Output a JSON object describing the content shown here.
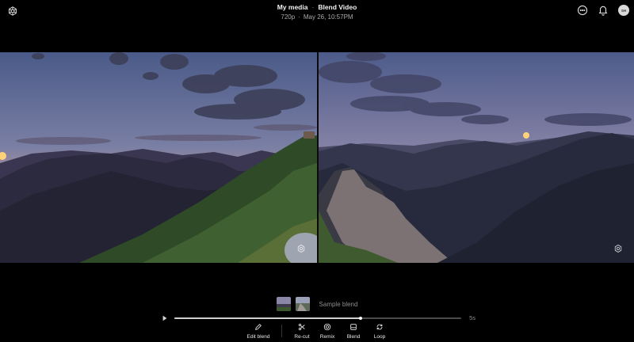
{
  "header": {
    "breadcrumb": [
      "My media",
      "Blend Video"
    ],
    "resolution": "720p",
    "date": "May 26, 10:57PM"
  },
  "icons": {
    "logo": "openai-logo-icon",
    "more": "more-options-icon",
    "notifications": "bell-icon",
    "avatar": "user-avatar"
  },
  "avatar_initials": "SH",
  "videos": [
    {
      "name": "left-clip",
      "description_icon": "watermark-icon"
    },
    {
      "name": "right-clip",
      "description_icon": "watermark-icon"
    }
  ],
  "blend": {
    "label": "Sample blend"
  },
  "player": {
    "duration": "5s",
    "progress": 0.65
  },
  "toolbar": {
    "edit_blend": "Edit blend",
    "recut": "Re-cut",
    "remix": "Remix",
    "blend": "Blend",
    "loop": "Loop"
  },
  "colors": {
    "background": "#000000",
    "muted_text": "#a9a9a9"
  }
}
